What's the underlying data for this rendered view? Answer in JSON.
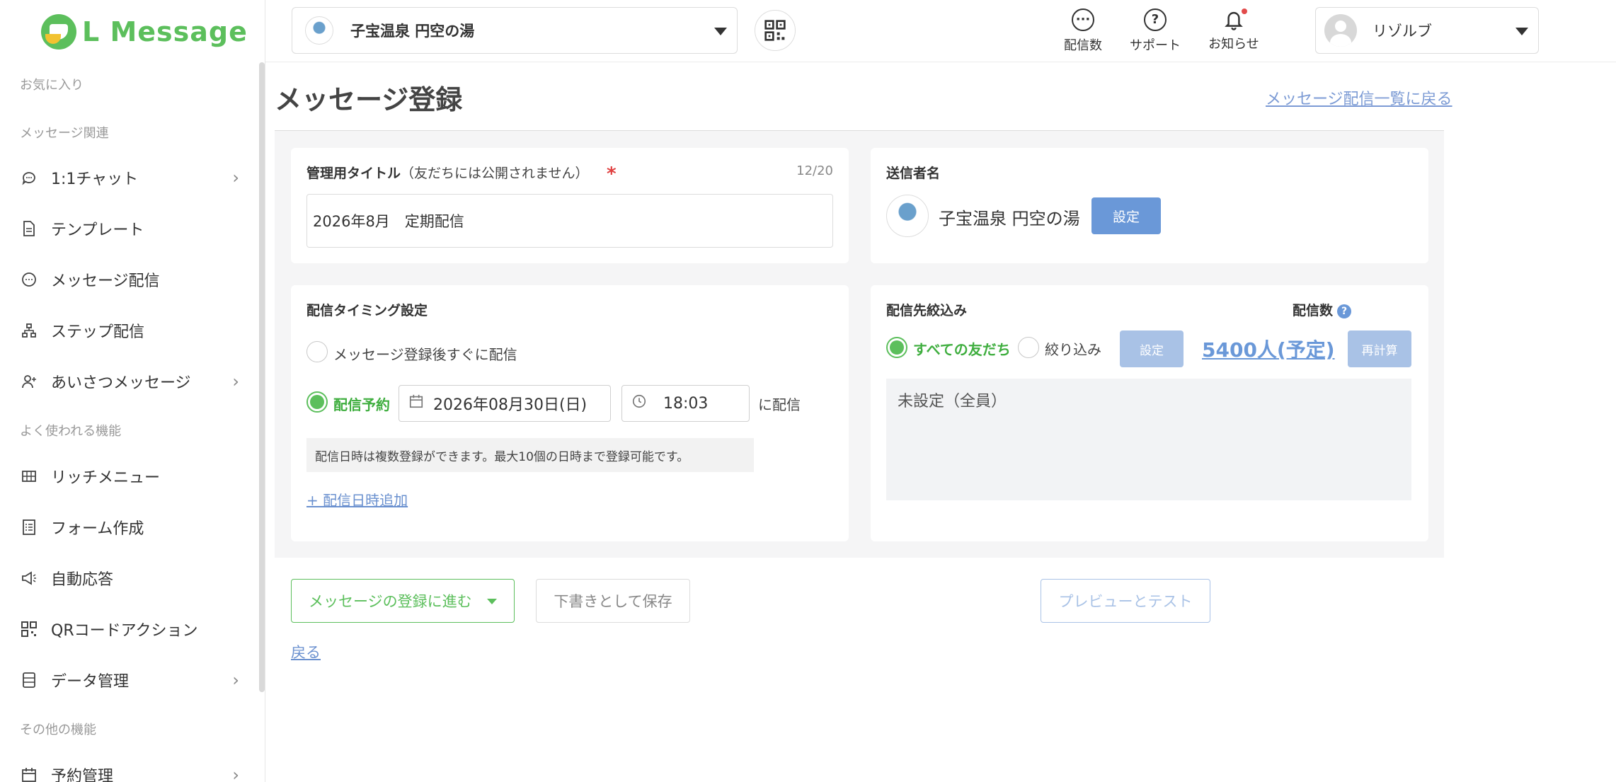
{
  "brand": {
    "logo_text": "L Message",
    "accent": "#5cbf5c"
  },
  "sidebar": {
    "sections": [
      {
        "label": "お気に入り"
      },
      {
        "label": "メッセージ関連"
      },
      {
        "label": "よく使われる機能"
      },
      {
        "label": "その他の機能"
      }
    ],
    "items": [
      {
        "label": "1:1チャット",
        "icon": "chat-icon",
        "has_chevron": true
      },
      {
        "label": "テンプレート",
        "icon": "document-icon",
        "has_chevron": false
      },
      {
        "label": "メッセージ配信",
        "icon": "message-icon",
        "has_chevron": false
      },
      {
        "label": "ステップ配信",
        "icon": "step-icon",
        "has_chevron": false
      },
      {
        "label": "あいさつメッセージ",
        "icon": "user-add-icon",
        "has_chevron": true
      },
      {
        "label": "リッチメニュー",
        "icon": "grid-icon",
        "has_chevron": false
      },
      {
        "label": "フォーム作成",
        "icon": "form-icon",
        "has_chevron": false
      },
      {
        "label": "自動応答",
        "icon": "megaphone-icon",
        "has_chevron": false
      },
      {
        "label": "QRコードアクション",
        "icon": "qr-icon",
        "has_chevron": false
      },
      {
        "label": "データ管理",
        "icon": "database-icon",
        "has_chevron": true
      },
      {
        "label": "予約管理",
        "icon": "calendar-icon",
        "has_chevron": true
      }
    ]
  },
  "header": {
    "account_name": "子宝温泉 円空の湯",
    "icons": [
      {
        "label": "配信数",
        "icon": "chat-bubble-icon"
      },
      {
        "label": "サポート",
        "icon": "help-icon"
      },
      {
        "label": "お知らせ",
        "icon": "bell-icon"
      }
    ],
    "user_name": "リゾルブ"
  },
  "main": {
    "title": "メッセージ登録",
    "back_to_list": "メッセージ配信一覧に戻る",
    "admin_title": {
      "label": "管理用タイトル",
      "note": "（友だちには公開されません）",
      "required_mark": "*",
      "counter": "12/20",
      "value": "2026年8月　定期配信"
    },
    "sender": {
      "label": "送信者名",
      "name": "子宝温泉 円空の湯",
      "button": "設定"
    },
    "timing": {
      "label": "配信タイミング設定",
      "option_immediate": "メッセージ登録後すぐに配信",
      "option_scheduled": "配信予約",
      "date": "2026年08月30日(日)",
      "time": "18:03",
      "suffix": "に配信",
      "hint": "配信日時は複数登録ができます。最大10個の日時まで登録可能です。",
      "add_link": "+ 配信日時追加"
    },
    "target": {
      "label": "配信先絞込み",
      "count_label": "配信数",
      "option_all": "すべての友だち",
      "option_filter": "絞り込み",
      "set_button": "設定",
      "count": "5400人(予定)",
      "recalc_button": "再計算",
      "filter_summary": "未設定（全員）"
    },
    "actions": {
      "proceed": "メッセージの登録に進む",
      "save_draft": "下書きとして保存",
      "preview": "プレビューとテスト",
      "back": "戻る"
    }
  }
}
